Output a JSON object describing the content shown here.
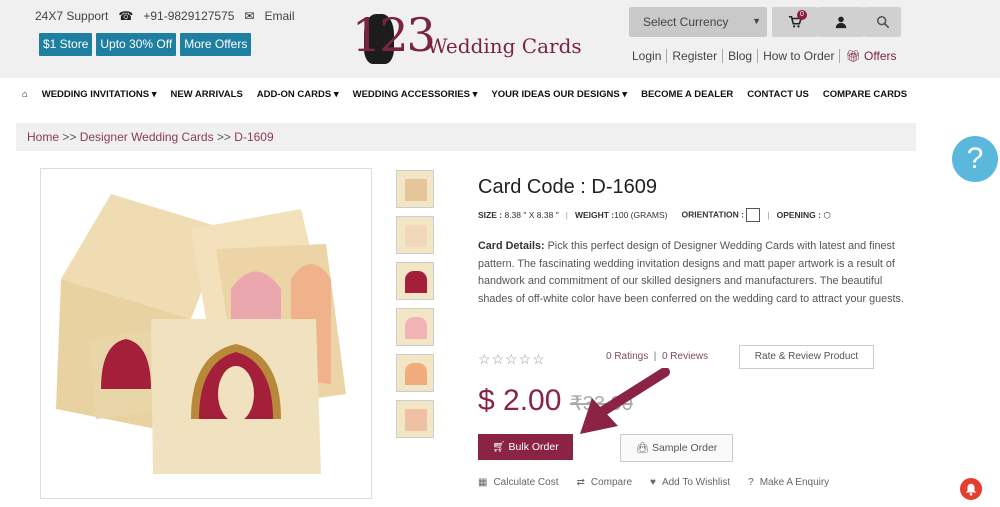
{
  "header": {
    "support_label": "24X7 Support",
    "phone": "+91-9829127575",
    "email_label": "Email",
    "promo_links": [
      "$1 Store",
      "Upto 30% Off",
      "More Offers"
    ],
    "logo_number": "123",
    "logo_text": "Wedding Cards",
    "currency_placeholder": "Select Currency",
    "cart_count": "0",
    "account_links": [
      "Login",
      "Register",
      "Blog",
      "How to Order",
      "Offers"
    ]
  },
  "nav": {
    "items": [
      "WEDDING INVITATIONS ▾",
      "NEW ARRIVALS",
      "ADD-ON CARDS ▾",
      "WEDDING ACCESSORIES ▾",
      "YOUR IDEAS OUR DESIGNS ▾",
      "BECOME A DEALER",
      "CONTACT US",
      "COMPARE CARDS"
    ]
  },
  "breadcrumb": {
    "home": "Home",
    "sep": ">>",
    "category": "Designer Wedding Cards",
    "current": "D-1609"
  },
  "help_label": "?",
  "product": {
    "title": "Card Code : D-1609",
    "size_label": "SIZE :",
    "size_value": "8.38 \" X 8.38 \"",
    "weight_label": "WEIGHT :",
    "weight_value": "100 (GRAMS)",
    "orientation_label": "ORIENTATION :",
    "opening_label": "OPENING :",
    "details_label": "Card Details:",
    "details_text": "Pick this perfect design of Designer Wedding Cards with latest and finest pattern. The fascinating wedding invitation designs and matt paper artwork is a result of handwork and commitment of our skilled designers and manufacturers. The beautiful shades of off-white color have been conferred on the wedding card to attract your guests.",
    "ratings_text": "0 Ratings",
    "reviews_text": "0 Reviews",
    "rate_button": "Rate & Review Product",
    "price": "$ 2.00",
    "old_price": "₹33.00",
    "bulk_button": "Bulk Order",
    "sample_button": "Sample Order",
    "tools": [
      "Calculate Cost",
      "Compare",
      "Add To Wishlist",
      "Make A Enquiry"
    ]
  },
  "colors": {
    "brand": "#8b2444",
    "promo_blue": "#1f7fa1",
    "help_blue": "#5ab8dc"
  }
}
